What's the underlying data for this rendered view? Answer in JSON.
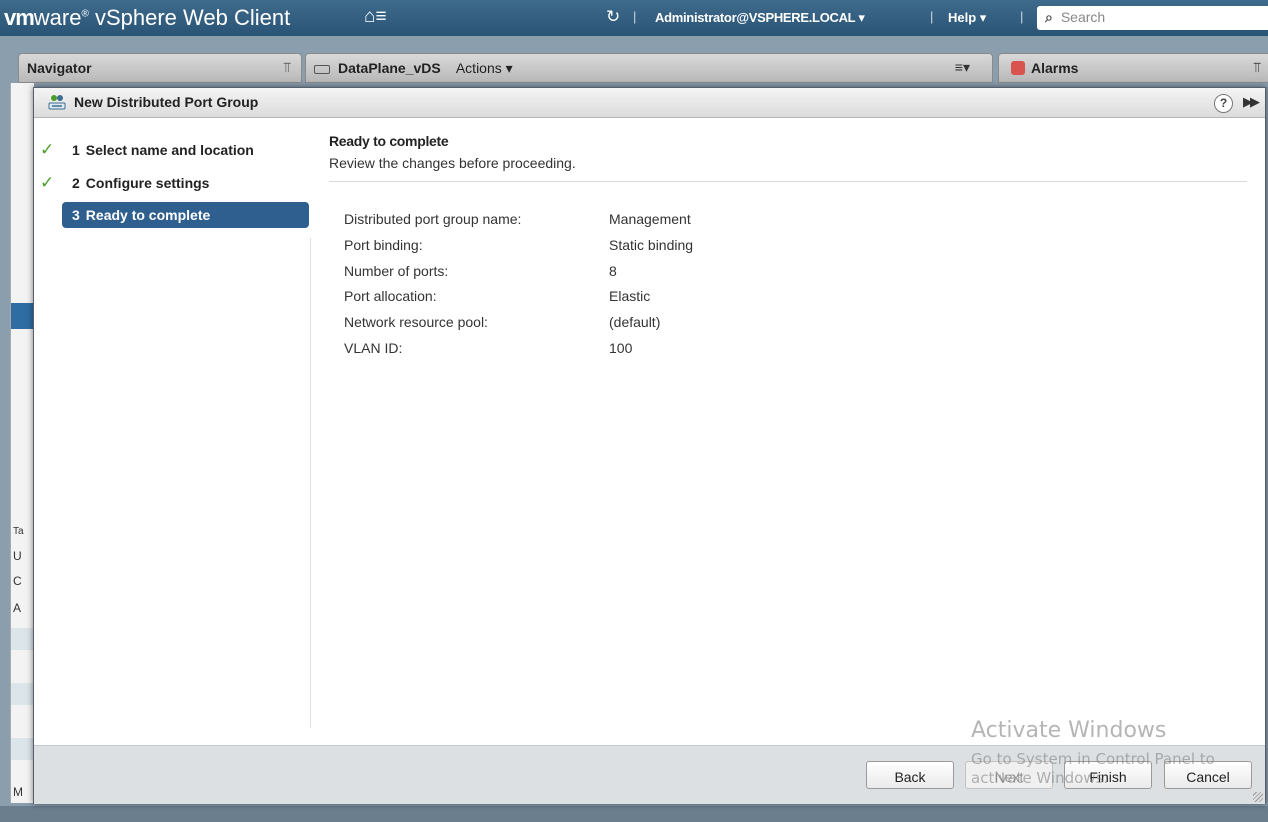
{
  "header": {
    "brand_vm": "vm",
    "brand_ware": "ware",
    "brand_reg": "®",
    "brand_product": " vSphere Web Client",
    "user": "Administrator@VSPHERE.LOCAL ▾",
    "help": "Help ▾",
    "search_placeholder": "Search",
    "home_icon": "home-icon",
    "refresh_icon": "refresh-icon"
  },
  "panels": {
    "navigator_title": "Navigator",
    "object_name": "DataPlane_vDS",
    "actions_label": "Actions ▾",
    "alarms_title": "Alarms"
  },
  "left_strip_letters": [
    "Ta",
    "U",
    "C",
    "A",
    "M"
  ],
  "dialog": {
    "title": "New Distributed Port Group",
    "steps": [
      {
        "number": "1",
        "label": "Select name and location",
        "completed": true
      },
      {
        "number": "2",
        "label": "Configure settings",
        "completed": true
      },
      {
        "number": "3",
        "label": "Ready to complete",
        "completed": false,
        "active": true
      }
    ],
    "content_title": "Ready to complete",
    "content_subtitle": "Review the changes before proceeding.",
    "summary": [
      {
        "key": "Distributed port group name:",
        "value": "Management"
      },
      {
        "key": "Port binding:",
        "value": "Static binding"
      },
      {
        "key": "Number of ports:",
        "value": "8"
      },
      {
        "key": "Port allocation:",
        "value": "Elastic"
      },
      {
        "key": "Network resource pool:",
        "value": "(default)"
      },
      {
        "key": "VLAN ID:",
        "value": "100"
      }
    ],
    "buttons": {
      "back": "Back",
      "next": "Next",
      "finish": "Finish",
      "cancel": "Cancel"
    }
  },
  "watermark": {
    "line1": "Activate Windows",
    "line2": "Go to System in Control Panel to",
    "line3": "activate Windows."
  },
  "colors": {
    "header_bg": "#2a5475",
    "active_step": "#2f5f8e",
    "check": "#4a9e29"
  }
}
